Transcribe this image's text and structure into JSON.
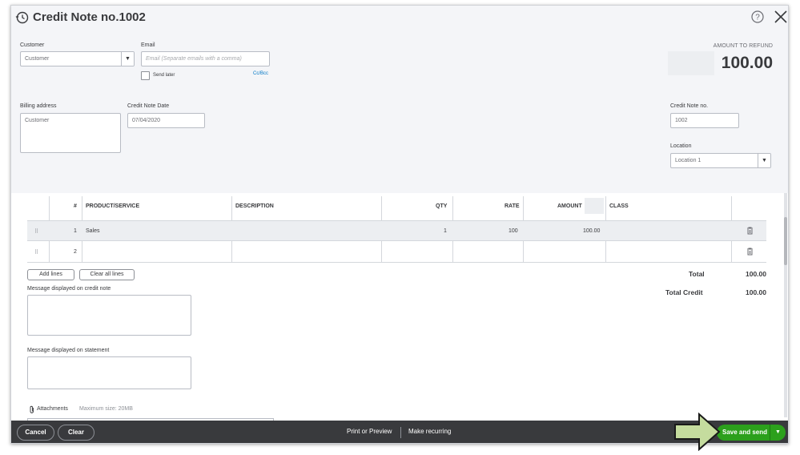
{
  "header": {
    "title": "Credit Note no.1002",
    "history_icon": "history-icon",
    "help_icon": "help-icon",
    "close_icon": "close-icon"
  },
  "customer": {
    "label": "Customer",
    "value": "Customer"
  },
  "email": {
    "label": "Email",
    "placeholder": "Email (Separate emails with a comma)",
    "send_later_label": "Send later",
    "send_later_checked": false,
    "ccbcc_link": "Cc/Bcc"
  },
  "amount_to_refund": {
    "label": "AMOUNT TO REFUND",
    "value": "100.00"
  },
  "billing_address": {
    "label": "Billing address",
    "value": "Customer"
  },
  "credit_note_date": {
    "label": "Credit Note Date",
    "value": "07/04/2020"
  },
  "credit_note_no": {
    "label": "Credit Note no.",
    "value": "1002"
  },
  "location": {
    "label": "Location",
    "value": "Location 1"
  },
  "table": {
    "columns": [
      "#",
      "PRODUCT/SERVICE",
      "DESCRIPTION",
      "QTY",
      "RATE",
      "AMOUNT",
      "CLASS"
    ],
    "rows": [
      {
        "num": "1",
        "product": "Sales",
        "description": "",
        "qty": "1",
        "rate": "100",
        "amount": "100.00",
        "class": ""
      },
      {
        "num": "2",
        "product": "",
        "description": "",
        "qty": "",
        "rate": "",
        "amount": "",
        "class": ""
      }
    ]
  },
  "actions": {
    "add_lines": "Add lines",
    "clear_all_lines": "Clear all lines"
  },
  "totals": {
    "total_label": "Total",
    "total_value": "100.00",
    "total_credit_label": "Total Credit",
    "total_credit_value": "100.00"
  },
  "messages": {
    "credit_note_label": "Message displayed on credit note",
    "statement_label": "Message displayed on statement"
  },
  "attachments": {
    "label": "Attachments",
    "max_size": "Maximum size: 20MB"
  },
  "footer": {
    "cancel": "Cancel",
    "clear": "Clear",
    "print_or_preview": "Print or Preview",
    "make_recurring": "Make recurring",
    "save_and_send": "Save and send"
  },
  "colors": {
    "primary_green": "#2ca01c",
    "footer_bg": "#393a3d",
    "link_blue": "#0077c5",
    "arrow_fill": "#c5dc9e"
  }
}
